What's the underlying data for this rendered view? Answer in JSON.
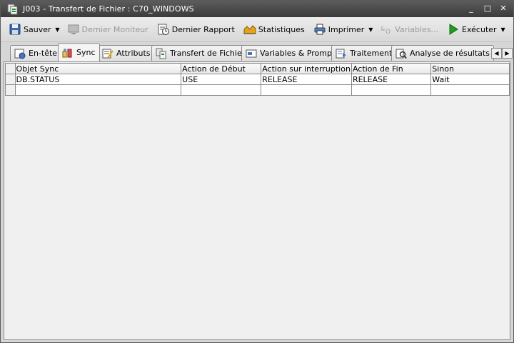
{
  "window": {
    "title": "J003 - Transfert de Fichier : C70_WINDOWS",
    "minimize_glyph": "_",
    "maximize_glyph": "□",
    "close_glyph": "✕"
  },
  "toolbar": {
    "save_label": "Sauver",
    "last_monitor_label": "Dernier Moniteur",
    "last_report_label": "Dernier Rapport",
    "statistics_label": "Statistiques",
    "print_label": "Imprimer",
    "variables_label": "Variables...",
    "execute_label": "Exécuter",
    "dropdown_glyph": "▼"
  },
  "tabs": [
    {
      "label": "En-tête",
      "icon": "header-icon"
    },
    {
      "label": "Sync",
      "icon": "sync-icon",
      "active": true
    },
    {
      "label": "Attributs",
      "icon": "attributes-icon"
    },
    {
      "label": "Transfert de Fichier",
      "icon": "file-transfer-icon"
    },
    {
      "label": "Variables & Prompts",
      "icon": "variables-icon"
    },
    {
      "label": "Traitement",
      "icon": "processing-icon"
    },
    {
      "label": "Analyse de résultats",
      "icon": "analysis-icon"
    }
  ],
  "tab_scroll": {
    "left": "◀",
    "right": "▶"
  },
  "grid": {
    "columns": [
      "Objet Sync",
      "Action de Début",
      "Action sur interruption",
      "Action de Fin",
      "Sinon"
    ],
    "rows": [
      [
        "DB.STATUS",
        "USE",
        "RELEASE",
        "RELEASE",
        "Wait"
      ],
      [
        "",
        "",
        "",
        "",
        ""
      ]
    ]
  },
  "colors": {
    "titlebar": "#3b3b3b",
    "execute_green": "#1e9e1e",
    "window_bg": "#d6d6d6",
    "content_bg": "#f0f0f0"
  }
}
